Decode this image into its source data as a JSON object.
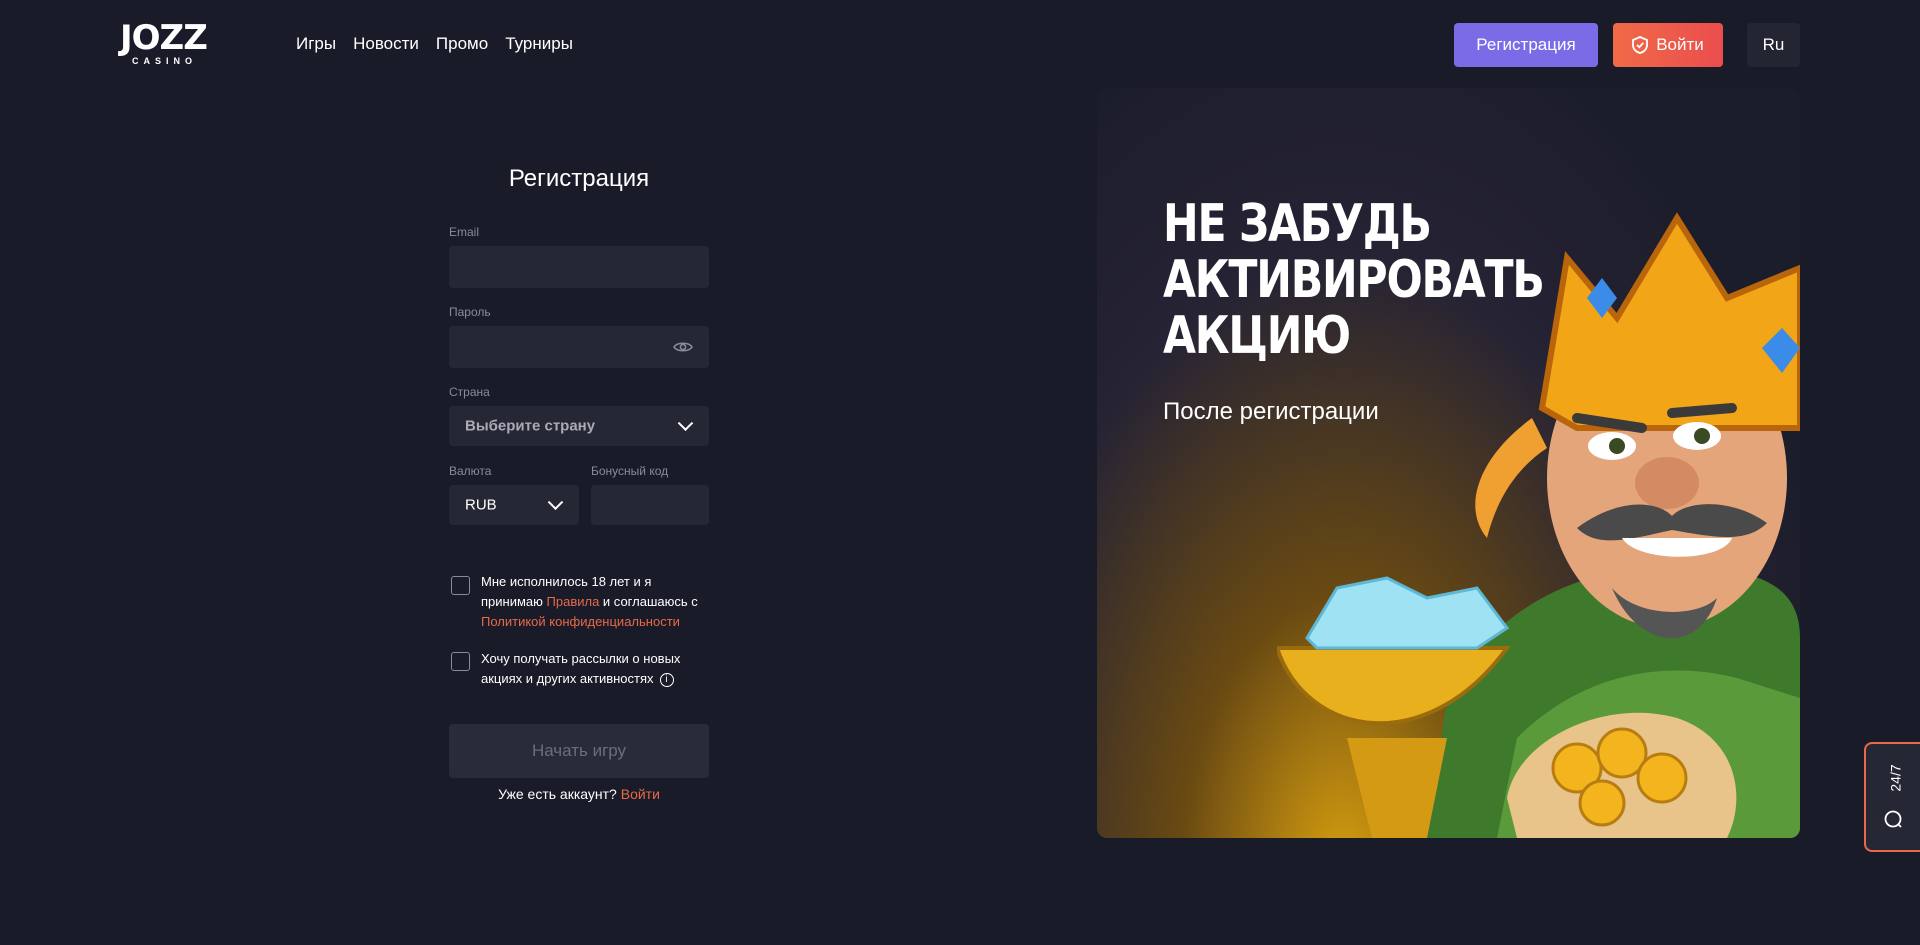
{
  "logo": {
    "main": "JOZZ",
    "sub": "CASINO"
  },
  "nav": [
    "Игры",
    "Новости",
    "Промо",
    "Турниры"
  ],
  "header": {
    "register_label": "Регистрация",
    "login_label": "Войти",
    "lang_label": "Ru"
  },
  "form": {
    "title": "Регистрация",
    "email_label": "Email",
    "email_value": "",
    "password_label": "Пароль",
    "password_value": "",
    "country_label": "Страна",
    "country_placeholder": "Выберите страну",
    "currency_label": "Валюта",
    "currency_value": "RUB",
    "bonus_label": "Бонусный код",
    "bonus_value": "",
    "consent_part1": "Мне исполнилось 18 лет и я принимаю",
    "consent_rules_link": "Правила",
    "consent_part2": " и соглашаюсь с ",
    "consent_privacy_link": "Политикой конфиденциальности",
    "newsletter_text": "Хочу получать рассылки о новых акциях и других активностях",
    "submit_label": "Начать игру",
    "have_account": "Уже есть аккаунт? ",
    "login_link": "Войти"
  },
  "banner": {
    "headline_line1": "НЕ ЗАБУДЬ",
    "headline_line2": "АКТИВИРОВАТЬ",
    "headline_line3": "АКЦИЮ",
    "subtitle": "После регистрации"
  },
  "support": {
    "label": "24/7"
  },
  "colors": {
    "background": "#1a1b28",
    "accent_purple": "#7a6ce7",
    "accent_orange": "#e8694a",
    "field_bg": "#262735"
  },
  "icons": [
    "shield-check-icon",
    "eye-icon",
    "chevron-down-icon",
    "info-icon",
    "chat-icon"
  ]
}
